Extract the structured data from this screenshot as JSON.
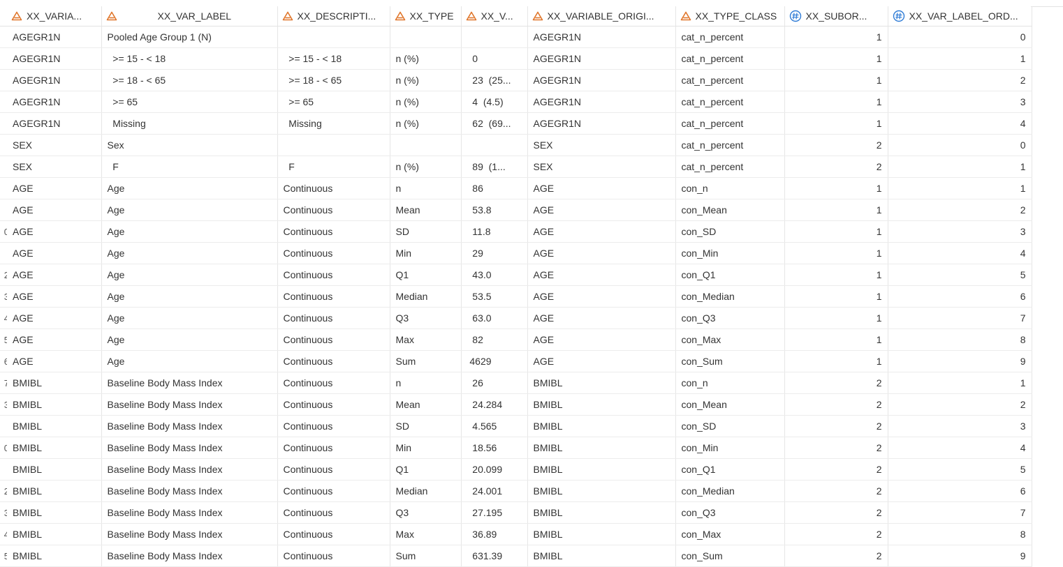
{
  "columns": [
    {
      "label": "XX_VARIA...",
      "type": "char"
    },
    {
      "label": "XX_VAR_LABEL",
      "type": "char"
    },
    {
      "label": "XX_DESCRIPTI...",
      "type": "char"
    },
    {
      "label": "XX_TYPE",
      "type": "char"
    },
    {
      "label": "XX_V...",
      "type": "char"
    },
    {
      "label": "XX_VARIABLE_ORIGI...",
      "type": "char"
    },
    {
      "label": "XX_TYPE_CLASS",
      "type": "char"
    },
    {
      "label": "XX_SUBOR...",
      "type": "numeric"
    },
    {
      "label": "XX_VAR_LABEL_ORD...",
      "type": "numeric"
    }
  ],
  "row_numbers": [
    "",
    "",
    "",
    "",
    "",
    "",
    "",
    "",
    "",
    "0",
    "",
    "2",
    "3",
    "4",
    "5",
    "6",
    "7",
    "3",
    "",
    "0",
    "",
    "2",
    "3",
    "4",
    "5"
  ],
  "rows": [
    [
      "AGEGR1N",
      "Pooled Age Group 1 (N)",
      "",
      "",
      "",
      "AGEGR1N",
      "cat_n_percent",
      "1",
      "0"
    ],
    [
      "AGEGR1N",
      "  >= 15 - < 18",
      "  >= 15 - < 18",
      "n (%)",
      "  0",
      "AGEGR1N",
      "cat_n_percent",
      "1",
      "1"
    ],
    [
      "AGEGR1N",
      "  >= 18 - < 65",
      "  >= 18 - < 65",
      "n (%)",
      "  23  (25...",
      "AGEGR1N",
      "cat_n_percent",
      "1",
      "2"
    ],
    [
      "AGEGR1N",
      "  >= 65",
      "  >= 65",
      "n (%)",
      "  4  (4.5)",
      "AGEGR1N",
      "cat_n_percent",
      "1",
      "3"
    ],
    [
      "AGEGR1N",
      "  Missing",
      "  Missing",
      "n (%)",
      "  62  (69...",
      "AGEGR1N",
      "cat_n_percent",
      "1",
      "4"
    ],
    [
      "SEX",
      "Sex",
      "",
      "",
      "",
      "SEX",
      "cat_n_percent",
      "2",
      "0"
    ],
    [
      "SEX",
      "  F",
      "  F",
      "n (%)",
      "  89  (1...",
      "SEX",
      "cat_n_percent",
      "2",
      "1"
    ],
    [
      "AGE",
      "Age",
      "Continuous",
      "n",
      "  86",
      "AGE",
      "con_n",
      "1",
      "1"
    ],
    [
      "AGE",
      "Age",
      "Continuous",
      "Mean",
      "  53.8",
      "AGE",
      "con_Mean",
      "1",
      "2"
    ],
    [
      "AGE",
      "Age",
      "Continuous",
      "SD",
      "  11.8",
      "AGE",
      "con_SD",
      "1",
      "3"
    ],
    [
      "AGE",
      "Age",
      "Continuous",
      "Min",
      "  29",
      "AGE",
      "con_Min",
      "1",
      "4"
    ],
    [
      "AGE",
      "Age",
      "Continuous",
      "Q1",
      "  43.0",
      "AGE",
      "con_Q1",
      "1",
      "5"
    ],
    [
      "AGE",
      "Age",
      "Continuous",
      "Median",
      "  53.5",
      "AGE",
      "con_Median",
      "1",
      "6"
    ],
    [
      "AGE",
      "Age",
      "Continuous",
      "Q3",
      "  63.0",
      "AGE",
      "con_Q3",
      "1",
      "7"
    ],
    [
      "AGE",
      "Age",
      "Continuous",
      "Max",
      "  82",
      "AGE",
      "con_Max",
      "1",
      "8"
    ],
    [
      "AGE",
      "Age",
      "Continuous",
      "Sum",
      " 4629",
      "AGE",
      "con_Sum",
      "1",
      "9"
    ],
    [
      "BMIBL",
      "Baseline Body Mass Index",
      "Continuous",
      "n",
      "  26",
      "BMIBL",
      "con_n",
      "2",
      "1"
    ],
    [
      "BMIBL",
      "Baseline Body Mass Index",
      "Continuous",
      "Mean",
      "  24.284",
      "BMIBL",
      "con_Mean",
      "2",
      "2"
    ],
    [
      "BMIBL",
      "Baseline Body Mass Index",
      "Continuous",
      "SD",
      "  4.565",
      "BMIBL",
      "con_SD",
      "2",
      "3"
    ],
    [
      "BMIBL",
      "Baseline Body Mass Index",
      "Continuous",
      "Min",
      "  18.56",
      "BMIBL",
      "con_Min",
      "2",
      "4"
    ],
    [
      "BMIBL",
      "Baseline Body Mass Index",
      "Continuous",
      "Q1",
      "  20.099",
      "BMIBL",
      "con_Q1",
      "2",
      "5"
    ],
    [
      "BMIBL",
      "Baseline Body Mass Index",
      "Continuous",
      "Median",
      "  24.001",
      "BMIBL",
      "con_Median",
      "2",
      "6"
    ],
    [
      "BMIBL",
      "Baseline Body Mass Index",
      "Continuous",
      "Q3",
      "  27.195",
      "BMIBL",
      "con_Q3",
      "2",
      "7"
    ],
    [
      "BMIBL",
      "Baseline Body Mass Index",
      "Continuous",
      "Max",
      "  36.89",
      "BMIBL",
      "con_Max",
      "2",
      "8"
    ],
    [
      "BMIBL",
      "Baseline Body Mass Index",
      "Continuous",
      "Sum",
      "  631.39",
      "BMIBL",
      "con_Sum",
      "2",
      "9"
    ]
  ],
  "icons": {
    "char_column": "character-type-icon",
    "numeric_column": "numeric-type-icon"
  },
  "colors": {
    "char_icon": "#e0762b",
    "numeric_icon": "#2e7bd6",
    "grid_line": "#e6e6e6"
  }
}
